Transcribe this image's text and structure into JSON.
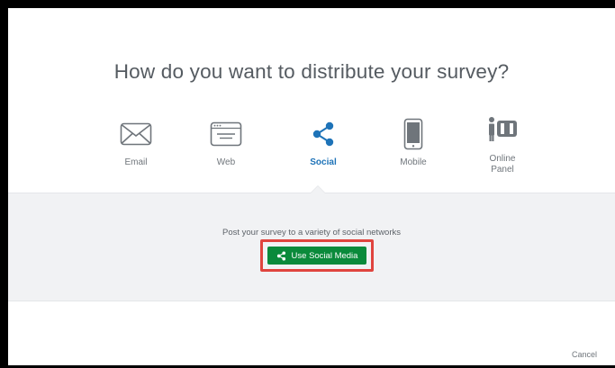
{
  "dialog": {
    "title": "How do you want to distribute your survey?"
  },
  "options": [
    {
      "id": "email",
      "label": "Email",
      "icon": "envelope-icon",
      "selected": false
    },
    {
      "id": "web",
      "label": "Web",
      "icon": "browser-window-icon",
      "selected": false
    },
    {
      "id": "social",
      "label": "Social",
      "icon": "share-icon",
      "selected": true
    },
    {
      "id": "mobile",
      "label": "Mobile",
      "icon": "phone-icon",
      "selected": false
    },
    {
      "id": "online-panel",
      "label": "Online Panel",
      "icon": "people-panel-icon",
      "selected": false
    }
  ],
  "panel": {
    "description": "Post your survey to a variety of social networks",
    "button_label": "Use Social Media",
    "button_icon": "share-icon"
  },
  "footer": {
    "cancel_label": "Cancel"
  },
  "colors": {
    "accent_blue": "#1e73b8",
    "button_green": "#0a8a3b",
    "highlight_red": "#e0443e",
    "panel_bg": "#f1f2f4"
  }
}
